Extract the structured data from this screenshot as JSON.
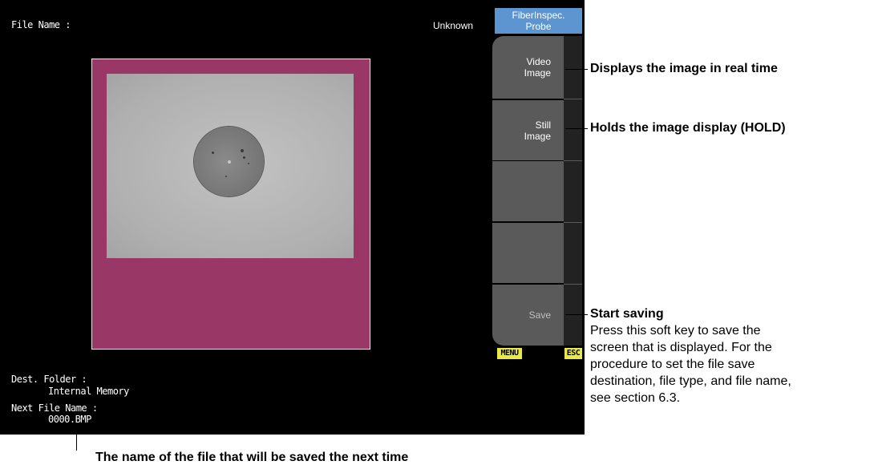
{
  "screen": {
    "file_name_label": "File Name :",
    "file_status": "Unknown",
    "title_line1": "FiberInspec.",
    "title_line2": "Probe",
    "dest_folder_label": "Dest. Folder :",
    "dest_folder_value": "Internal Memory",
    "next_file_label": "Next File Name :",
    "next_file_value": "0000.BMP",
    "menu_badge": "MENU",
    "esc_badge": "ESC"
  },
  "softkeys": [
    {
      "line1": "Video",
      "line2": "Image"
    },
    {
      "line1": "Still",
      "line2": "Image"
    },
    {
      "line1": "",
      "line2": ""
    },
    {
      "line1": "",
      "line2": ""
    },
    {
      "line1": "Save",
      "line2": ""
    }
  ],
  "callouts": {
    "video": "Displays the image in real time",
    "still": "Holds the image display (HOLD)",
    "save_title": "Start saving",
    "save_desc_1": "Press this soft key to save the",
    "save_desc_2": "screen that is displayed. For the",
    "save_desc_3": "procedure to set the file save",
    "save_desc_4": "destination, file type, and file name,",
    "save_desc_5": "see section 6.3.",
    "next_file": "The name of the file that will be saved the next time"
  },
  "colors": {
    "screen_bg": "#000000",
    "title_bg": "#5d95d0",
    "image_frame": "#993767",
    "softkey_bg": "#5a5a5a",
    "badge_bg": "#e8e84a"
  }
}
